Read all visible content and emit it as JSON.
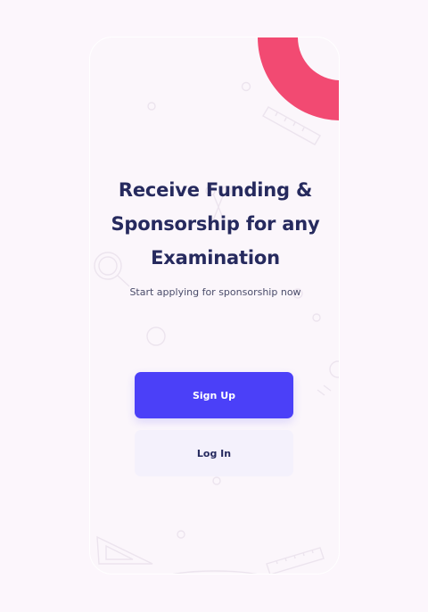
{
  "screen": {
    "headline_line1": "Receive Funding &",
    "headline_line2": "Sponsorship for any",
    "headline_line3": "Examination",
    "subtitle": "Start applying for sponsorship now"
  },
  "actions": {
    "signup_label": "Sign Up",
    "login_label": "Log In"
  },
  "colors": {
    "background": "#fcf6fc",
    "title": "#262a5e",
    "primary": "#4b40f8",
    "secondary": "#f4f1fc",
    "accent": "#f24a72"
  },
  "icons": {
    "background_pattern": "stationery-doodles",
    "corner_shape": "quarter-ring"
  }
}
